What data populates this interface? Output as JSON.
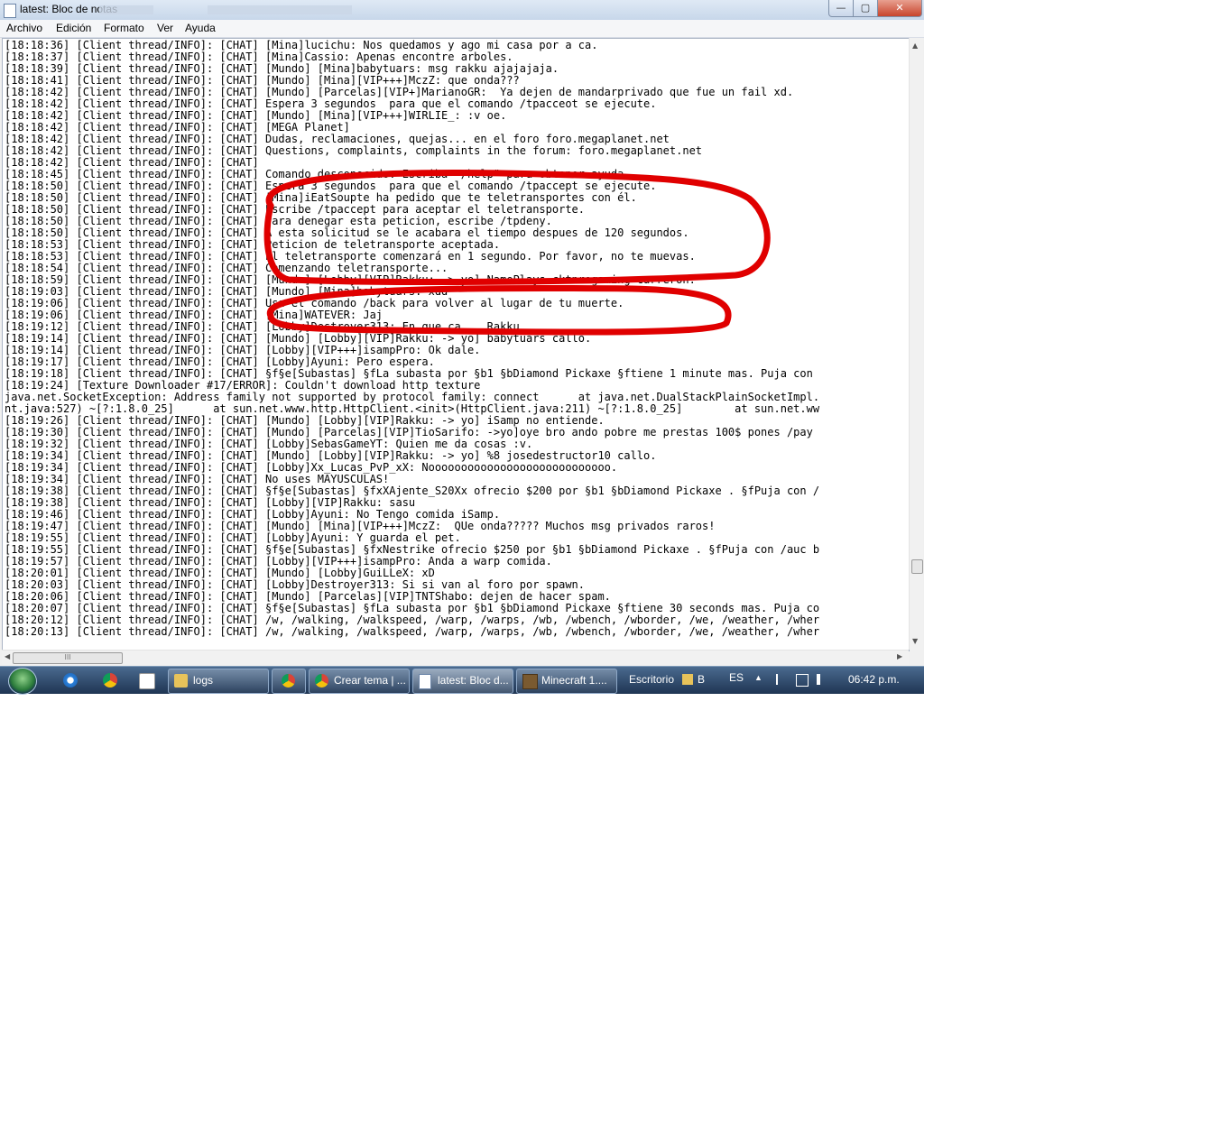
{
  "window": {
    "title": "latest: Bloc de notas",
    "controls": {
      "minimize": "—",
      "maximize": "▢",
      "close": "✕"
    }
  },
  "menu": [
    "Archivo",
    "Edición",
    "Formato",
    "Ver",
    "Ayuda"
  ],
  "log_lines": [
    "[18:18:36] [Client thread/INFO]: [CHAT] [Mina]lucichu: Nos quedamos y ago mi casa por a ca.",
    "[18:18:37] [Client thread/INFO]: [CHAT] [Mina]Cassio: Apenas encontre arboles.",
    "[18:18:39] [Client thread/INFO]: [CHAT] [Mundo] [Mina]babytuars: msg rakku ajajajaja.",
    "[18:18:41] [Client thread/INFO]: [CHAT] [Mundo] [Mina][VIP+++]MczZ: que onda???",
    "[18:18:42] [Client thread/INFO]: [CHAT] [Mundo] [Parcelas][VIP+]MarianoGR:  Ya dejen de mandarprivado que fue un fail xd.",
    "[18:18:42] [Client thread/INFO]: [CHAT] Espera 3 segundos  para que el comando /tpacceot se ejecute.",
    "[18:18:42] [Client thread/INFO]: [CHAT] [Mundo] [Mina][VIP+++]WIRLIE_: :v oe.",
    "[18:18:42] [Client thread/INFO]: [CHAT] [MEGA Planet]",
    "[18:18:42] [Client thread/INFO]: [CHAT] Dudas, reclamaciones, quejas... en el foro foro.megaplanet.net",
    "[18:18:42] [Client thread/INFO]: [CHAT] Questions, complaints, complaints in the forum: foro.megaplanet.net",
    "[18:18:42] [Client thread/INFO]: [CHAT]",
    "[18:18:45] [Client thread/INFO]: [CHAT] Comando desconocido. Escriba \"/help\" para obtener ayuda.",
    "[18:18:50] [Client thread/INFO]: [CHAT] Espera 3 segundos  para que el comando /tpaccept se ejecute.",
    "[18:18:50] [Client thread/INFO]: [CHAT] [Mina]iEatSoupte ha pedido que te teletransportes con él.",
    "[18:18:50] [Client thread/INFO]: [CHAT] Escribe /tpaccept para aceptar el teletransporte.",
    "[18:18:50] [Client thread/INFO]: [CHAT] Para denegar esta peticion, escribe /tpdeny.",
    "[18:18:50] [Client thread/INFO]: [CHAT] A esta solicitud se le acabara el tiempo despues de 120 segundos.",
    "[18:18:53] [Client thread/INFO]: [CHAT] Peticion de teletransporte aceptada.",
    "[18:18:53] [Client thread/INFO]: [CHAT] El teletransporte comenzará en 1 segundo. Por favor, no te muevas.",
    "[18:18:54] [Client thread/INFO]: [CHAT] Comenzando teletransporte...",
    "[18:18:59] [Client thread/INFO]: [CHAT] [Mundo] [Lobby][VIP]Rakku: -> yo] NamePlays cktnrogaming carreron.",
    "[18:19:03] [Client thread/INFO]: [CHAT] [Mundo] [Mina]babytuars: xdd",
    "[18:19:06] [Client thread/INFO]: [CHAT] Usa el comando /back para volver al lugar de tu muerte.",
    "[18:19:06] [Client thread/INFO]: [CHAT] [Mina]WATEVER: Jaj",
    "[18:19:12] [Client thread/INFO]: [CHAT] [Lobby]Destroyer313: En que ca... Rakku",
    "[18:19:14] [Client thread/INFO]: [CHAT] [Mundo] [Lobby][VIP]Rakku: -> yo] babytuars callo.",
    "[18:19:14] [Client thread/INFO]: [CHAT] [Lobby][VIP+++]isampPro: Ok dale.",
    "[18:19:17] [Client thread/INFO]: [CHAT] [Lobby]Ayuni: Pero espera.",
    "[18:19:18] [Client thread/INFO]: [CHAT] §f§e[Subastas] §fLa subasta por §b1 §bDiamond Pickaxe §ftiene 1 minute mas. Puja con",
    "[18:19:24] [Texture Downloader #17/ERROR]: Couldn't download http texture",
    "java.net.SocketException: Address family not supported by protocol family: connect      at java.net.DualStackPlainSocketImpl.",
    "nt.java:527) ~[?:1.8.0_25]      at sun.net.www.http.HttpClient.<init>(HttpClient.java:211) ~[?:1.8.0_25]        at sun.net.ww",
    "[18:19:26] [Client thread/INFO]: [CHAT] [Mundo] [Lobby][VIP]Rakku: -> yo] iSamp no entiende.",
    "[18:19:30] [Client thread/INFO]: [CHAT] [Mundo] [Parcelas][VIP]TioSarifo: ->yo]oye bro ando pobre me prestas 100$ pones /pay",
    "[18:19:32] [Client thread/INFO]: [CHAT] [Lobby]SebasGameYT: Quien me da cosas :v.",
    "[18:19:34] [Client thread/INFO]: [CHAT] [Mundo] [Lobby][VIP]Rakku: -> yo] %8 josedestructor10 callo.",
    "[18:19:34] [Client thread/INFO]: [CHAT] [Lobby]Xx_Lucas_PvP_xX: Noooooooooooooooooooooooooooo.",
    "[18:19:34] [Client thread/INFO]: [CHAT] No uses MAYUSCULAS!",
    "[18:19:38] [Client thread/INFO]: [CHAT] §f§e[Subastas] §fxXAjente_S20Xx ofrecio $200 por §b1 §bDiamond Pickaxe . §fPuja con /",
    "[18:19:38] [Client thread/INFO]: [CHAT] [Lobby][VIP]Rakku: sasu",
    "[18:19:46] [Client thread/INFO]: [CHAT] [Lobby]Ayuni: No Tengo comida iSamp.",
    "[18:19:47] [Client thread/INFO]: [CHAT] [Mundo] [Mina][VIP+++]MczZ:  QUe onda????? Muchos msg privados raros!",
    "[18:19:55] [Client thread/INFO]: [CHAT] [Lobby]Ayuni: Y guarda el pet.",
    "[18:19:55] [Client thread/INFO]: [CHAT] §f§e[Subastas] §fxNestrike ofrecio $250 por §b1 §bDiamond Pickaxe . §fPuja con /auc b",
    "[18:19:57] [Client thread/INFO]: [CHAT] [Lobby][VIP+++]isampPro: Anda a warp comida.",
    "[18:20:01] [Client thread/INFO]: [CHAT] [Mundo] [Lobby]GuiLLeX: xD",
    "[18:20:03] [Client thread/INFO]: [CHAT] [Lobby]Destroyer313: Si si van al foro por spawn.",
    "[18:20:06] [Client thread/INFO]: [CHAT] [Mundo] [Parcelas][VIP]TNTShabo: dejen de hacer spam.",
    "[18:20:07] [Client thread/INFO]: [CHAT] §f§e[Subastas] §fLa subasta por §b1 §bDiamond Pickaxe §ftiene 30 seconds mas. Puja co",
    "[18:20:12] [Client thread/INFO]: [CHAT] /w, /walking, /walkspeed, /warp, /warps, /wb, /wbench, /wborder, /we, /weather, /wher",
    "[18:20:13] [Client thread/INFO]: [CHAT] /w, /walking, /walkspeed, /warp, /warps, /wb, /wbench, /wborder, /we, /weather, /wher"
  ],
  "hscroll_grip": "III",
  "taskbar": {
    "tasks": [
      {
        "label": "logs",
        "icon": "folder-icon"
      },
      {
        "label": "Crear tema | ...",
        "icon": "chrome-icon"
      },
      {
        "label": "latest: Bloc d...",
        "icon": "notepad-icon"
      },
      {
        "label": "Minecraft 1....",
        "icon": "minecraft-icon"
      }
    ],
    "desktop_label": "Escritorio",
    "tray_letter": "B",
    "language": "ES",
    "clock": "06:42 p.m."
  },
  "colors": {
    "annotation_red": "#e00000",
    "taskbar": "#1f3553",
    "editor_bg": "#ffffff"
  }
}
